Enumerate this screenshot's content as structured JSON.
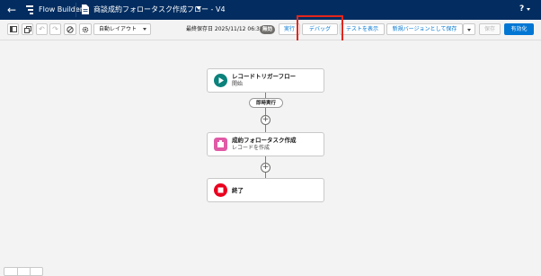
{
  "header": {
    "back_icon": "back-arrow-icon",
    "app_name": "Flow Builder",
    "doc_title": "商談成約フォロータスク作成フロー - V4",
    "help_label": "?"
  },
  "toolbar": {
    "layout_select": "自動レイアウト",
    "last_saved": "最終保存日 2025/11/12 06:35",
    "status_badge": "無効",
    "run_label": "実行",
    "debug_label": "デバッグ",
    "view_tests_label": "テストを表示",
    "save_new_version_label": "新規バージョンとして保存",
    "save_label": "保存",
    "activate_label": "有効化"
  },
  "canvas": {
    "start_node": {
      "title": "レコードトリガーフロー",
      "subtitle": "開始"
    },
    "run_immediately_label": "即時実行",
    "create_node": {
      "title": "成約フォロータスク作成",
      "subtitle": "レコードを作成"
    },
    "end_node": {
      "title": "終了"
    }
  },
  "colors": {
    "header_bg": "#032d60",
    "brand_blue": "#0176d3",
    "start_icon": "#0b827c",
    "create_icon": "#e05aa6",
    "end_icon": "#ea001e",
    "highlight_box": "#e3261c"
  }
}
